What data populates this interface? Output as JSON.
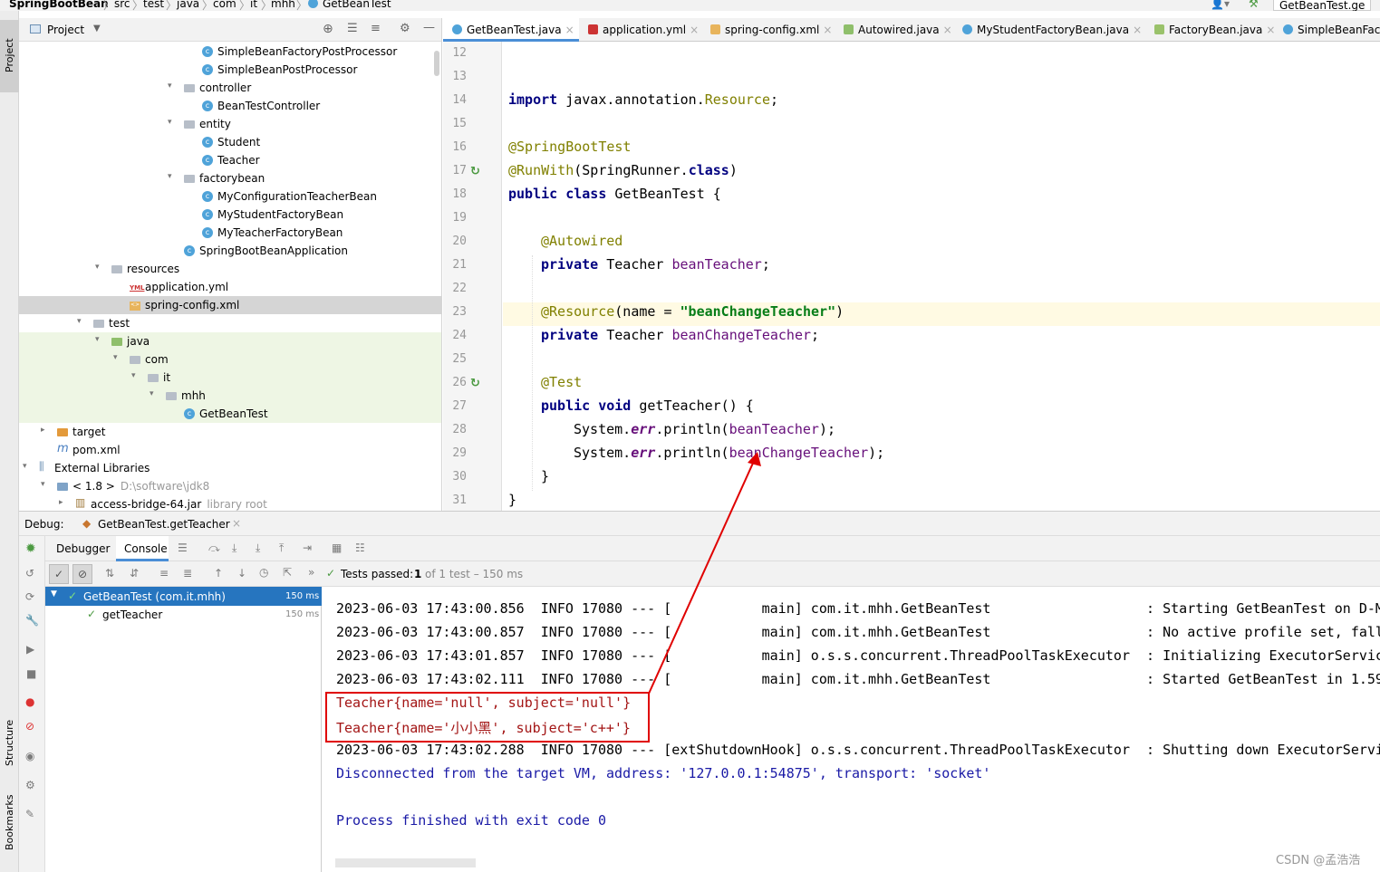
{
  "breadcrumb": {
    "project": "SpringBootBean",
    "parts": [
      "src",
      "test",
      "java",
      "com",
      "it",
      "mhh"
    ],
    "file": "GetBeanTest",
    "right_tab": "GetBeanTest.ge"
  },
  "left_strip": {
    "project_label": "Project",
    "structure_label": "Structure",
    "bookmarks_label": "Bookmarks"
  },
  "project_panel": {
    "header_label": "Project",
    "tree": [
      {
        "label": "SimpleBeanFactoryPostProcessor",
        "icon": "class-icon",
        "depth": 9,
        "arrow": ""
      },
      {
        "label": "SimpleBeanPostProcessor",
        "icon": "class-icon",
        "depth": 9,
        "arrow": ""
      },
      {
        "label": "controller",
        "icon": "folder-icon",
        "depth": 8,
        "arrow": "v"
      },
      {
        "label": "BeanTestController",
        "icon": "class-icon",
        "depth": 9,
        "arrow": ""
      },
      {
        "label": "entity",
        "icon": "folder-icon",
        "depth": 8,
        "arrow": "v"
      },
      {
        "label": "Student",
        "icon": "class-icon",
        "depth": 9,
        "arrow": ""
      },
      {
        "label": "Teacher",
        "icon": "class-icon",
        "depth": 9,
        "arrow": ""
      },
      {
        "label": "factorybean",
        "icon": "folder-icon",
        "depth": 8,
        "arrow": "v"
      },
      {
        "label": "MyConfigurationTeacherBean",
        "icon": "class-icon",
        "depth": 9,
        "arrow": ""
      },
      {
        "label": "MyStudentFactoryBean",
        "icon": "class-icon",
        "depth": 9,
        "arrow": ""
      },
      {
        "label": "MyTeacherFactoryBean",
        "icon": "class-icon",
        "depth": 9,
        "arrow": ""
      },
      {
        "label": "SpringBootBeanApplication",
        "icon": "spring-class-icon",
        "depth": 8,
        "arrow": ""
      },
      {
        "label": "resources",
        "icon": "folder-icon",
        "depth": 4,
        "arrow": "v"
      },
      {
        "label": "application.yml",
        "icon": "yml-icon",
        "depth": 5,
        "arrow": ""
      },
      {
        "label": "spring-config.xml",
        "icon": "xml-icon",
        "depth": 5,
        "arrow": ""
      },
      {
        "label": "test",
        "icon": "folder-icon",
        "depth": 3,
        "arrow": "v"
      },
      {
        "label": "java",
        "icon": "folder-green-icon",
        "depth": 4,
        "arrow": "v"
      },
      {
        "label": "com",
        "icon": "package-icon",
        "depth": 5,
        "arrow": "v"
      },
      {
        "label": "it",
        "icon": "package-icon",
        "depth": 6,
        "arrow": "v"
      },
      {
        "label": "mhh",
        "icon": "package-icon",
        "depth": 7,
        "arrow": "v"
      },
      {
        "label": "GetBeanTest",
        "icon": "spring-class-icon",
        "depth": 8,
        "arrow": ""
      },
      {
        "label": "target",
        "icon": "folder-orange-icon",
        "depth": 1,
        "arrow": ">"
      },
      {
        "label": "pom.xml",
        "icon": "maven-icon",
        "depth": 1,
        "arrow": ""
      },
      {
        "label": "External Libraries",
        "icon": "library-icon",
        "depth": 0,
        "arrow": "v"
      },
      {
        "label": "< 1.8 >",
        "suffix": "D:\\software\\jdk8",
        "icon": "jdk-icon",
        "depth": 1,
        "arrow": "v"
      },
      {
        "label": "access-bridge-64.jar",
        "suffix": "library root",
        "icon": "jar-icon",
        "depth": 2,
        "arrow": ">"
      }
    ]
  },
  "editor": {
    "tabs": [
      {
        "label": "GetBeanTest.java",
        "active": true
      },
      {
        "label": "application.yml",
        "active": false
      },
      {
        "label": "spring-config.xml",
        "active": false
      },
      {
        "label": "Autowired.java",
        "active": false
      },
      {
        "label": "MyStudentFactoryBean.java",
        "active": false
      },
      {
        "label": "FactoryBean.java",
        "active": false
      },
      {
        "label": "SimpleBeanFact",
        "active": false
      }
    ],
    "line_numbers": [
      "12",
      "13",
      "14",
      "15",
      "16",
      "17",
      "18",
      "19",
      "20",
      "21",
      "22",
      "23",
      "24",
      "25",
      "26",
      "27",
      "28",
      "29",
      "30",
      "31"
    ],
    "code": {
      "l13_import": "import",
      "l13_pkg": " javax.annotation.",
      "l13_cls": "Resource",
      "l13_end": ";",
      "l15": "@SpringBootTest",
      "l16_ann": "@RunWith",
      "l16_rest": "(SpringRunner.",
      "l16_kw": "class",
      "l16_end": ")",
      "l17_kw": "public class",
      "l17_rest": " GetBeanTest {",
      "l19": "@Autowired",
      "l20_kw": "private",
      "l20_type": " Teacher ",
      "l20_fld": "beanTeacher",
      "l20_end": ";",
      "l22_ann": "@Resource",
      "l22_rest": "(name = ",
      "l22_str": "\"beanChangeTeacher\"",
      "l22_end": ")",
      "l23_kw": "private",
      "l23_type": " Teacher ",
      "l23_fld": "beanChangeTeacher",
      "l23_end": ";",
      "l25": "@Test",
      "l26_kw": "public void",
      "l26_rest": " getTeacher() {",
      "l27_a": "System.",
      "l27_err": "err",
      "l27_b": ".println(",
      "l27_fld": "beanTeacher",
      "l27_c": ");",
      "l28_a": "System.",
      "l28_err": "err",
      "l28_b": ".println(",
      "l28_fld": "beanChangeTeacher",
      "l28_c": ");",
      "l29": "}",
      "l30": "}"
    }
  },
  "debug": {
    "label": "Debug:",
    "session_tab": "GetBeanTest.getTeacher",
    "tabs": {
      "debugger": "Debugger",
      "console": "Console"
    },
    "status_prefix": "Tests passed:",
    "status_count": "1",
    "status_suffix": "of 1 test – 150 ms",
    "test_tree": [
      {
        "label": "GetBeanTest (com.it.mhh)",
        "time": "150 ms",
        "selected": true
      },
      {
        "label": "getTeacher",
        "time": "150 ms",
        "selected": false
      }
    ],
    "console_lines": [
      {
        "text": "2023-06-03 17:43:00.856  INFO 17080 --- [           main] com.it.mhh.GetBeanTest                   : Starting GetBeanTest on D-M",
        "style": "normal"
      },
      {
        "text": "2023-06-03 17:43:00.857  INFO 17080 --- [           main] com.it.mhh.GetBeanTest                   : No active profile set, fall",
        "style": "normal"
      },
      {
        "text": "2023-06-03 17:43:01.857  INFO 17080 --- [           main] o.s.s.concurrent.ThreadPoolTaskExecutor  : Initializing ExecutorServic",
        "style": "normal"
      },
      {
        "text": "2023-06-03 17:43:02.111  INFO 17080 --- [           main] com.it.mhh.GetBeanTest                   : Started GetBeanTest in 1.59",
        "style": "normal"
      },
      {
        "text": "Teacher{name='null', subject='null'}",
        "style": "red"
      },
      {
        "text": "Teacher{name='小小黑', subject='c++'}",
        "style": "red"
      },
      {
        "text": "2023-06-03 17:43:02.288  INFO 17080 --- [extShutdownHook] o.s.s.concurrent.ThreadPoolTaskExecutor  : Shutting down ExecutorServi",
        "style": "normal"
      },
      {
        "text": "Disconnected from the target VM, address: '127.0.0.1:54875', transport: 'socket'",
        "style": "blue"
      },
      {
        "text": "",
        "style": "normal"
      },
      {
        "text": "Process finished with exit code 0",
        "style": "blue"
      }
    ]
  },
  "watermark": "CSDN @孟浩浩",
  "colors": {
    "annotation_red": "#e00000",
    "selection_blue": "#2675bf",
    "active_tab_accent": "#4a8ed6"
  }
}
